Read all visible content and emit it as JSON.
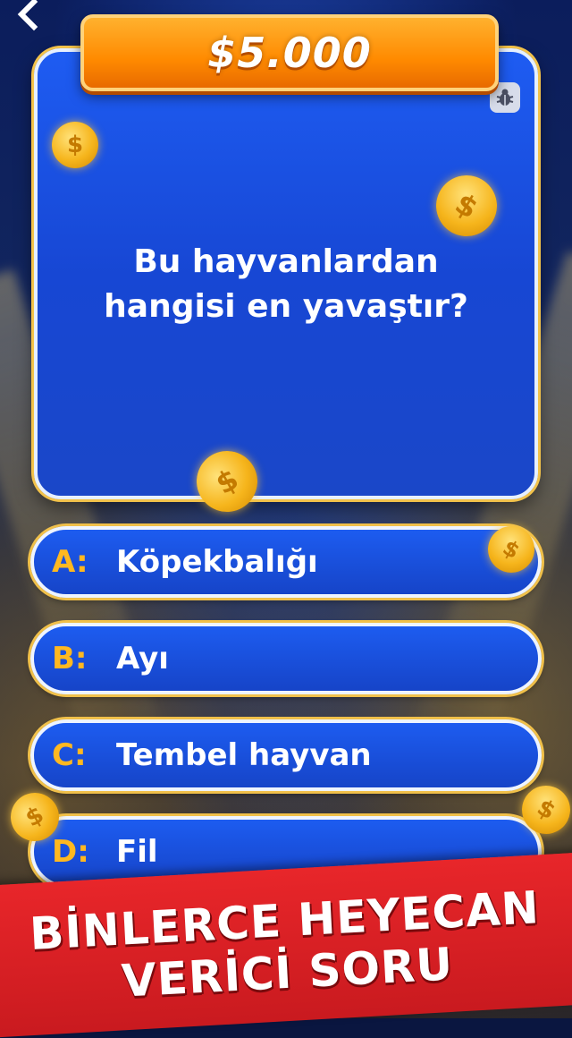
{
  "prize": {
    "amount": "$5.000"
  },
  "question": {
    "text": "Bu hayvanlardan hangisi en yavaştır?"
  },
  "answers": [
    {
      "letter": "A:",
      "text": "Köpekbalığı"
    },
    {
      "letter": "B:",
      "text": "Ayı"
    },
    {
      "letter": "C:",
      "text": "Tembel hayvan"
    },
    {
      "letter": "D:",
      "text": "Fil"
    }
  ],
  "promo": {
    "line1": "BİNLERCE HEYECAN",
    "line2": "VERİCİ SORU"
  },
  "icons": {
    "back": "back-arrow-icon",
    "report": "bug-icon",
    "coin": "dollar-coin-icon"
  },
  "colors": {
    "accent": "#ff9a00",
    "answer_letter": "#ffb820",
    "card_blue": "#1d5cf0",
    "promo_red": "#e8262a"
  }
}
